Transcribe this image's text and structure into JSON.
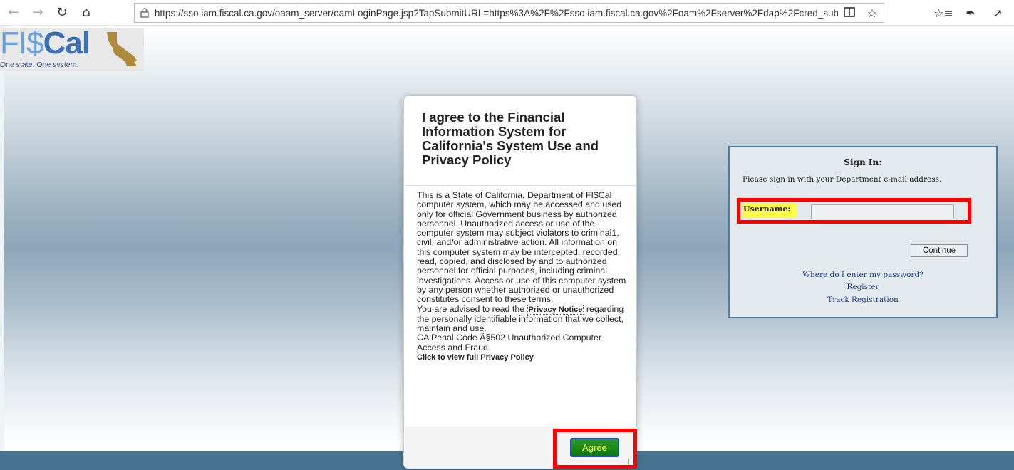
{
  "browser": {
    "url": "https://sso.iam.fiscal.ca.gov/oaam_server/oamLoginPage.jsp?TapSubmitURL=https%3A%2F%2Fsso.iam.fiscal.ca.gov%2Foam%2Fserver%2Fdap%2Fcred_submit",
    "icons": [
      "back-icon",
      "forward-icon",
      "refresh-icon",
      "home-icon",
      "lock-icon",
      "reading-view-icon",
      "favorite-star-icon",
      "favorites-list-icon",
      "pen-icon",
      "share-icon"
    ]
  },
  "logo": {
    "fi": "FI",
    "dollar": "$",
    "cal": "Cal",
    "tagline": "One state. One system."
  },
  "privacy_modal": {
    "title": "I agree to the Financial Information System for California's System Use and Privacy Policy",
    "body_main": "This is a State of California, Department of FI$Cal computer system, which may be accessed and used only for official Government business by authorized personnel. Unauthorized access or use of the computer system may subject violators to criminal1, civil, and/or administrative action. All information on this computer system may be intercepted, recorded, read, copied, and disclosed by and to authorized personnel for official purposes, including criminal investigations. Access or use of this computer system by any person whether authorized or unauthorized constitutes consent to these terms.",
    "advised_prefix": "You are advised to read the ",
    "privacy_notice_link": "Privacy Notice",
    "advised_suffix": " regarding the personally identifiable information that we collect, maintain and use.",
    "penal_code": "CA Penal Code Â§502 Unauthorized Computer Access and Fraud.",
    "full_policy_link": "Click to view full Privacy Policy",
    "agree_label": "Agree"
  },
  "signin": {
    "title": "Sign In:",
    "instruction": "Please sign in with your Department e-mail address.",
    "username_label": "Username:",
    "username_value": "",
    "continue_label": "Continue",
    "links": {
      "password": "Where do I enter my password?",
      "register": "Register",
      "track": "Track Registration"
    }
  },
  "colors": {
    "highlight_border": "#ff0000",
    "agree_bg": "#1a8a1a",
    "agree_text": "#ffff55",
    "username_highlight": "#ffff44",
    "footer_band": "#477591",
    "link": "#1a3f8f"
  }
}
